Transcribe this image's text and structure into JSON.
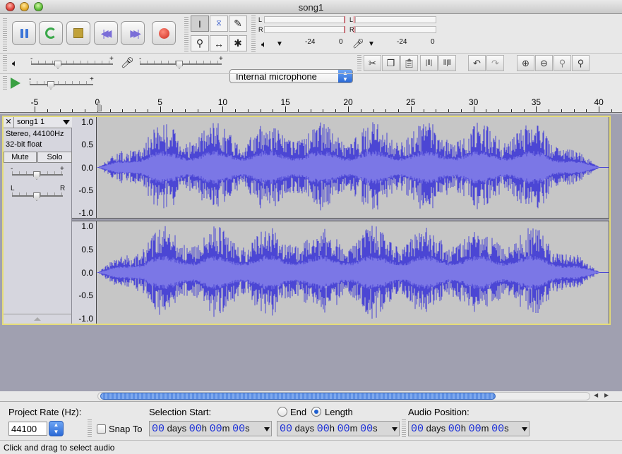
{
  "window": {
    "title": "song1"
  },
  "meters": {
    "playback": {
      "left": "L",
      "right": "R",
      "scale_marks": [
        "-24",
        "0"
      ]
    },
    "record": {
      "left": "L",
      "right": "R",
      "scale_marks": [
        "-24",
        "0"
      ]
    }
  },
  "mixer": {
    "minus": "-",
    "plus": "+"
  },
  "input_source": {
    "selected": "Internal microphone"
  },
  "play_at_speed": {
    "minus": "-",
    "plus": "+"
  },
  "ruler": {
    "labels": [
      "-5",
      "0",
      "5",
      "10",
      "15",
      "20",
      "25",
      "30",
      "35",
      "40"
    ]
  },
  "track": {
    "name": "song1 1",
    "info_line1": "Stereo, 44100Hz",
    "info_line2": "32-bit float",
    "mute_label": "Mute",
    "solo_label": "Solo",
    "gain_minus": "-",
    "gain_plus": "+",
    "pan_left": "L",
    "pan_right": "R",
    "channel_scale": [
      "1.0",
      "0.5",
      "0.0",
      "-0.5",
      "-1.0"
    ],
    "waveform_color": "#4b46d4",
    "waveform_rms_color": "#7b77e6"
  },
  "selection_bar": {
    "project_rate_label": "Project Rate (Hz):",
    "project_rate_value": "44100",
    "snap_to_label": "Snap To",
    "selection_start_label": "Selection Start:",
    "end_label": "End",
    "length_label": "Length",
    "length_selected": true,
    "audio_position_label": "Audio Position:",
    "time_units": {
      "days": "days",
      "h": "h",
      "m": "m",
      "s": "s"
    },
    "selection_start": {
      "days": "00",
      "h": "00",
      "m": "00",
      "s": "00"
    },
    "selection_end": {
      "days": "00",
      "h": "00",
      "m": "00",
      "s": "00"
    },
    "audio_position": {
      "days": "00",
      "h": "00",
      "m": "00",
      "s": "00"
    }
  },
  "status": {
    "text": "Click and drag to select audio"
  }
}
